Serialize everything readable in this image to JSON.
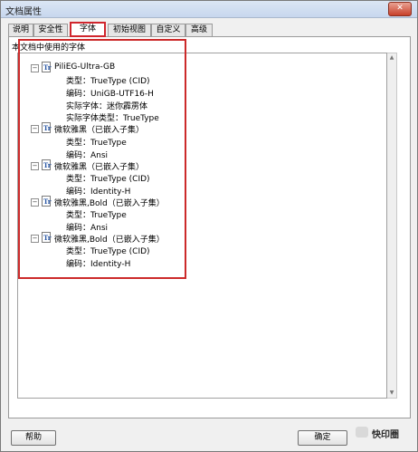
{
  "window": {
    "title": "文档属性",
    "close_glyph": "✕"
  },
  "tabs": [
    {
      "label": "说明"
    },
    {
      "label": "安全性"
    },
    {
      "label": "字体",
      "active": true
    },
    {
      "label": "初始视图"
    },
    {
      "label": "自定义"
    },
    {
      "label": "高级"
    }
  ],
  "section_label": "本文档中使用的字体",
  "fonts": [
    {
      "name": "PiliEG-Ultra-GB",
      "props": [
        "类型：TrueType (CID)",
        "编码：UniGB-UTF16-H",
        "实际字体：迷你霹雳体",
        "实际字体类型：TrueType"
      ]
    },
    {
      "name": "微软雅黑（已嵌入子集）",
      "props": [
        "类型：TrueType",
        "编码：Ansi"
      ]
    },
    {
      "name": "微软雅黑（已嵌入子集）",
      "props": [
        "类型：TrueType (CID)",
        "编码：Identity-H"
      ]
    },
    {
      "name": "微软雅黑,Bold（已嵌入子集）",
      "props": [
        "类型：TrueType",
        "编码：Ansi"
      ]
    },
    {
      "name": "微软雅黑,Bold（已嵌入子集）",
      "props": [
        "类型：TrueType (CID)",
        "编码：Identity-H"
      ]
    }
  ],
  "tree_icon": {
    "icon": "font-file-icon",
    "glyph": "Tr",
    "expander": "−"
  },
  "buttons": {
    "help": "帮助",
    "ok": "确定"
  },
  "watermark": {
    "text": "快印圈"
  },
  "colors": {
    "highlight": "#cc2a2a",
    "active_tab_border": "#d0262d"
  }
}
